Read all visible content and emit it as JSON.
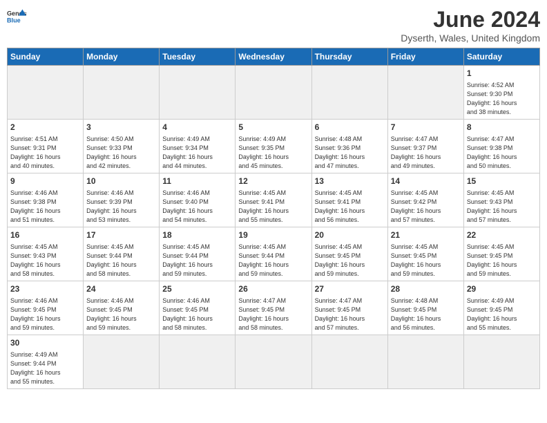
{
  "header": {
    "logo_general": "General",
    "logo_blue": "Blue",
    "month_title": "June 2024",
    "location": "Dyserth, Wales, United Kingdom"
  },
  "days_of_week": [
    "Sunday",
    "Monday",
    "Tuesday",
    "Wednesday",
    "Thursday",
    "Friday",
    "Saturday"
  ],
  "weeks": [
    [
      {
        "day": "",
        "info": ""
      },
      {
        "day": "",
        "info": ""
      },
      {
        "day": "",
        "info": ""
      },
      {
        "day": "",
        "info": ""
      },
      {
        "day": "",
        "info": ""
      },
      {
        "day": "",
        "info": ""
      },
      {
        "day": "1",
        "info": "Sunrise: 4:52 AM\nSunset: 9:30 PM\nDaylight: 16 hours\nand 38 minutes."
      }
    ],
    [
      {
        "day": "2",
        "info": "Sunrise: 4:51 AM\nSunset: 9:31 PM\nDaylight: 16 hours\nand 40 minutes."
      },
      {
        "day": "3",
        "info": "Sunrise: 4:50 AM\nSunset: 9:33 PM\nDaylight: 16 hours\nand 42 minutes."
      },
      {
        "day": "4",
        "info": "Sunrise: 4:49 AM\nSunset: 9:34 PM\nDaylight: 16 hours\nand 44 minutes."
      },
      {
        "day": "5",
        "info": "Sunrise: 4:49 AM\nSunset: 9:35 PM\nDaylight: 16 hours\nand 45 minutes."
      },
      {
        "day": "6",
        "info": "Sunrise: 4:48 AM\nSunset: 9:36 PM\nDaylight: 16 hours\nand 47 minutes."
      },
      {
        "day": "7",
        "info": "Sunrise: 4:47 AM\nSunset: 9:37 PM\nDaylight: 16 hours\nand 49 minutes."
      },
      {
        "day": "8",
        "info": "Sunrise: 4:47 AM\nSunset: 9:38 PM\nDaylight: 16 hours\nand 50 minutes."
      }
    ],
    [
      {
        "day": "9",
        "info": "Sunrise: 4:46 AM\nSunset: 9:38 PM\nDaylight: 16 hours\nand 51 minutes."
      },
      {
        "day": "10",
        "info": "Sunrise: 4:46 AM\nSunset: 9:39 PM\nDaylight: 16 hours\nand 53 minutes."
      },
      {
        "day": "11",
        "info": "Sunrise: 4:46 AM\nSunset: 9:40 PM\nDaylight: 16 hours\nand 54 minutes."
      },
      {
        "day": "12",
        "info": "Sunrise: 4:45 AM\nSunset: 9:41 PM\nDaylight: 16 hours\nand 55 minutes."
      },
      {
        "day": "13",
        "info": "Sunrise: 4:45 AM\nSunset: 9:41 PM\nDaylight: 16 hours\nand 56 minutes."
      },
      {
        "day": "14",
        "info": "Sunrise: 4:45 AM\nSunset: 9:42 PM\nDaylight: 16 hours\nand 57 minutes."
      },
      {
        "day": "15",
        "info": "Sunrise: 4:45 AM\nSunset: 9:43 PM\nDaylight: 16 hours\nand 57 minutes."
      }
    ],
    [
      {
        "day": "16",
        "info": "Sunrise: 4:45 AM\nSunset: 9:43 PM\nDaylight: 16 hours\nand 58 minutes."
      },
      {
        "day": "17",
        "info": "Sunrise: 4:45 AM\nSunset: 9:44 PM\nDaylight: 16 hours\nand 58 minutes."
      },
      {
        "day": "18",
        "info": "Sunrise: 4:45 AM\nSunset: 9:44 PM\nDaylight: 16 hours\nand 59 minutes."
      },
      {
        "day": "19",
        "info": "Sunrise: 4:45 AM\nSunset: 9:44 PM\nDaylight: 16 hours\nand 59 minutes."
      },
      {
        "day": "20",
        "info": "Sunrise: 4:45 AM\nSunset: 9:45 PM\nDaylight: 16 hours\nand 59 minutes."
      },
      {
        "day": "21",
        "info": "Sunrise: 4:45 AM\nSunset: 9:45 PM\nDaylight: 16 hours\nand 59 minutes."
      },
      {
        "day": "22",
        "info": "Sunrise: 4:45 AM\nSunset: 9:45 PM\nDaylight: 16 hours\nand 59 minutes."
      }
    ],
    [
      {
        "day": "23",
        "info": "Sunrise: 4:46 AM\nSunset: 9:45 PM\nDaylight: 16 hours\nand 59 minutes."
      },
      {
        "day": "24",
        "info": "Sunrise: 4:46 AM\nSunset: 9:45 PM\nDaylight: 16 hours\nand 59 minutes."
      },
      {
        "day": "25",
        "info": "Sunrise: 4:46 AM\nSunset: 9:45 PM\nDaylight: 16 hours\nand 58 minutes."
      },
      {
        "day": "26",
        "info": "Sunrise: 4:47 AM\nSunset: 9:45 PM\nDaylight: 16 hours\nand 58 minutes."
      },
      {
        "day": "27",
        "info": "Sunrise: 4:47 AM\nSunset: 9:45 PM\nDaylight: 16 hours\nand 57 minutes."
      },
      {
        "day": "28",
        "info": "Sunrise: 4:48 AM\nSunset: 9:45 PM\nDaylight: 16 hours\nand 56 minutes."
      },
      {
        "day": "29",
        "info": "Sunrise: 4:49 AM\nSunset: 9:45 PM\nDaylight: 16 hours\nand 55 minutes."
      }
    ],
    [
      {
        "day": "30",
        "info": "Sunrise: 4:49 AM\nSunset: 9:44 PM\nDaylight: 16 hours\nand 55 minutes."
      },
      {
        "day": "",
        "info": ""
      },
      {
        "day": "",
        "info": ""
      },
      {
        "day": "",
        "info": ""
      },
      {
        "day": "",
        "info": ""
      },
      {
        "day": "",
        "info": ""
      },
      {
        "day": "",
        "info": ""
      }
    ]
  ]
}
